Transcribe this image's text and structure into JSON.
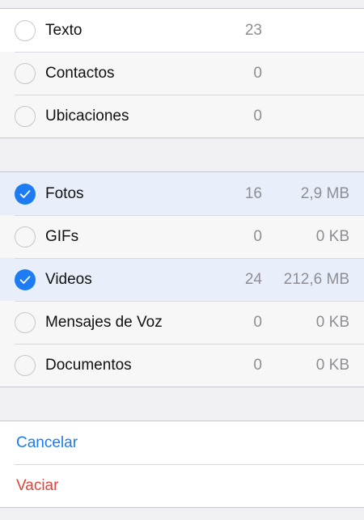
{
  "colors": {
    "accent": "#1d7cf2",
    "destructive": "#e4413a",
    "selected_row": "#e8effb",
    "background": "#efeff4"
  },
  "group1": {
    "items": [
      {
        "label": "Texto",
        "count": "23",
        "selected": false
      },
      {
        "label": "Contactos",
        "count": "0",
        "selected": false
      },
      {
        "label": "Ubicaciones",
        "count": "0",
        "selected": false
      }
    ]
  },
  "group2": {
    "items": [
      {
        "label": "Fotos",
        "count": "16",
        "size": "2,9 MB",
        "selected": true
      },
      {
        "label": "GIFs",
        "count": "0",
        "size": "0 KB",
        "selected": false
      },
      {
        "label": "Videos",
        "count": "24",
        "size": "212,6 MB",
        "selected": true
      },
      {
        "label": "Mensajes de Voz",
        "count": "0",
        "size": "0 KB",
        "selected": false
      },
      {
        "label": "Documentos",
        "count": "0",
        "size": "0 KB",
        "selected": false
      }
    ]
  },
  "actions": {
    "cancel_label": "Cancelar",
    "clear_label": "Vaciar"
  }
}
